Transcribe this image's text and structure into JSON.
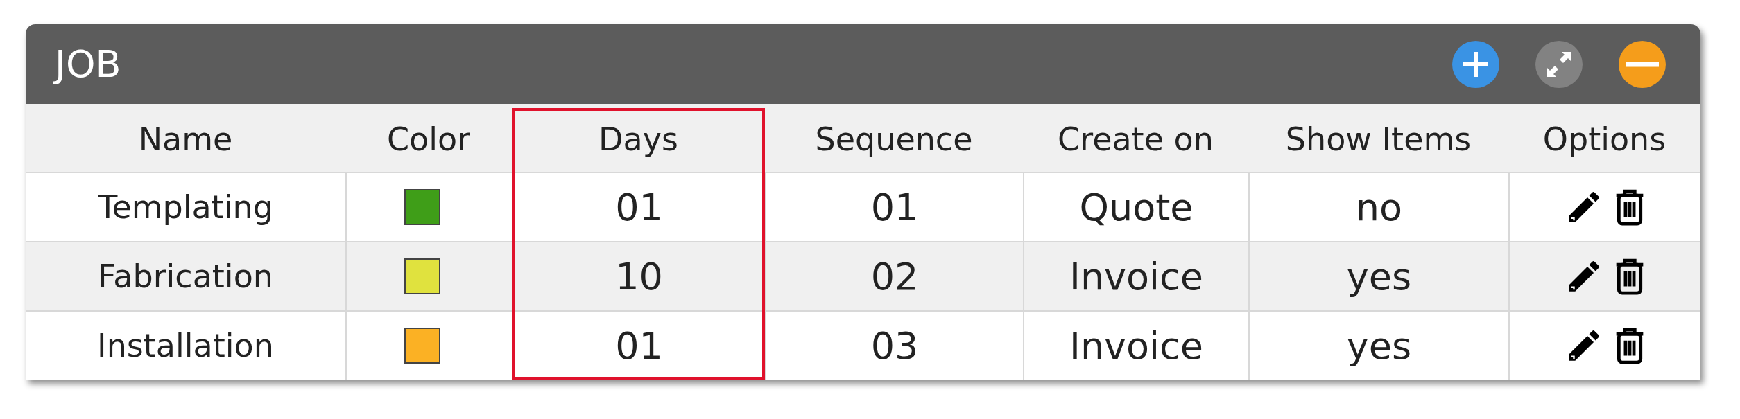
{
  "panel": {
    "title": "JOB"
  },
  "table": {
    "columns": [
      {
        "label": "Name",
        "highlighted": false
      },
      {
        "label": "Color",
        "highlighted": false
      },
      {
        "label": "Days",
        "highlighted": true
      },
      {
        "label": "Sequence",
        "highlighted": false
      },
      {
        "label": "Create on",
        "highlighted": false
      },
      {
        "label": "Show Items",
        "highlighted": false
      },
      {
        "label": "Options",
        "highlighted": false
      }
    ],
    "rows": [
      {
        "name": "Templating",
        "color": "#3f9e18",
        "days": "01",
        "sequence": "01",
        "create_on": "Quote",
        "show_items": "no"
      },
      {
        "name": "Fabrication",
        "color": "#e0e23e",
        "days": "10",
        "sequence": "02",
        "create_on": "Invoice",
        "show_items": "yes"
      },
      {
        "name": "Installation",
        "color": "#fbb124",
        "days": "01",
        "sequence": "03",
        "create_on": "Invoice",
        "show_items": "yes"
      }
    ]
  }
}
